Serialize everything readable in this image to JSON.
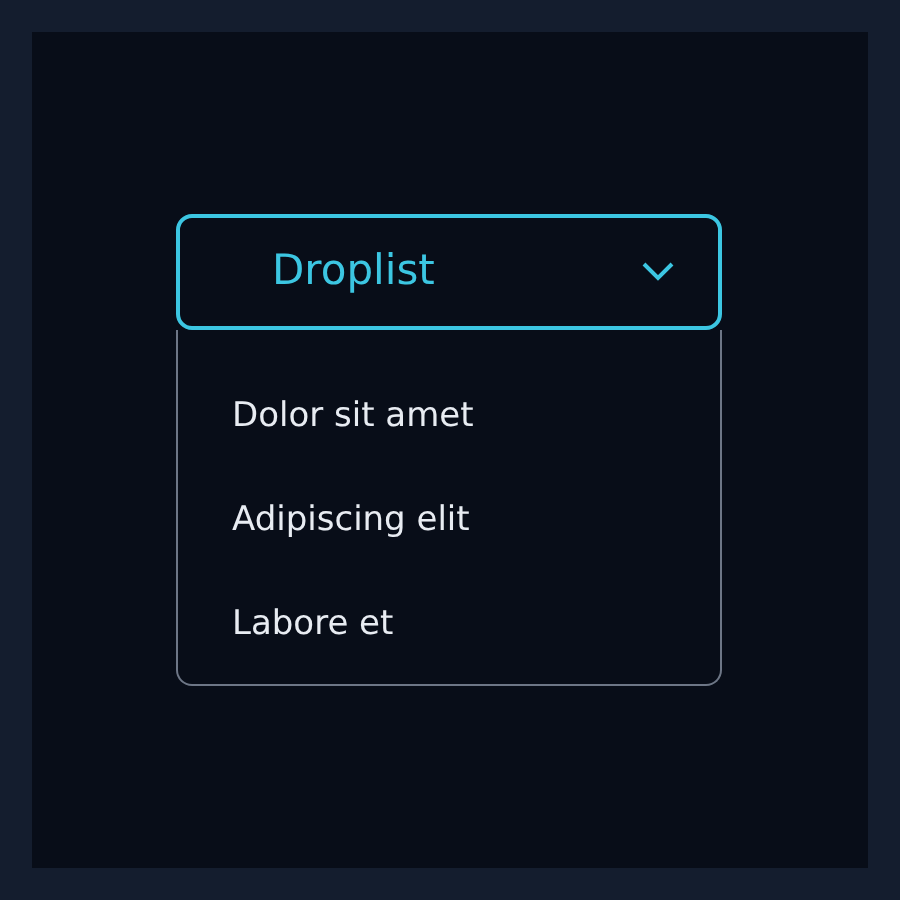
{
  "dropdown": {
    "label": "Droplist",
    "expanded": true
  },
  "items": [
    {
      "label": "Dolor sit amet"
    },
    {
      "label": "Adipiscing elit"
    },
    {
      "label": "Labore et"
    }
  ]
}
